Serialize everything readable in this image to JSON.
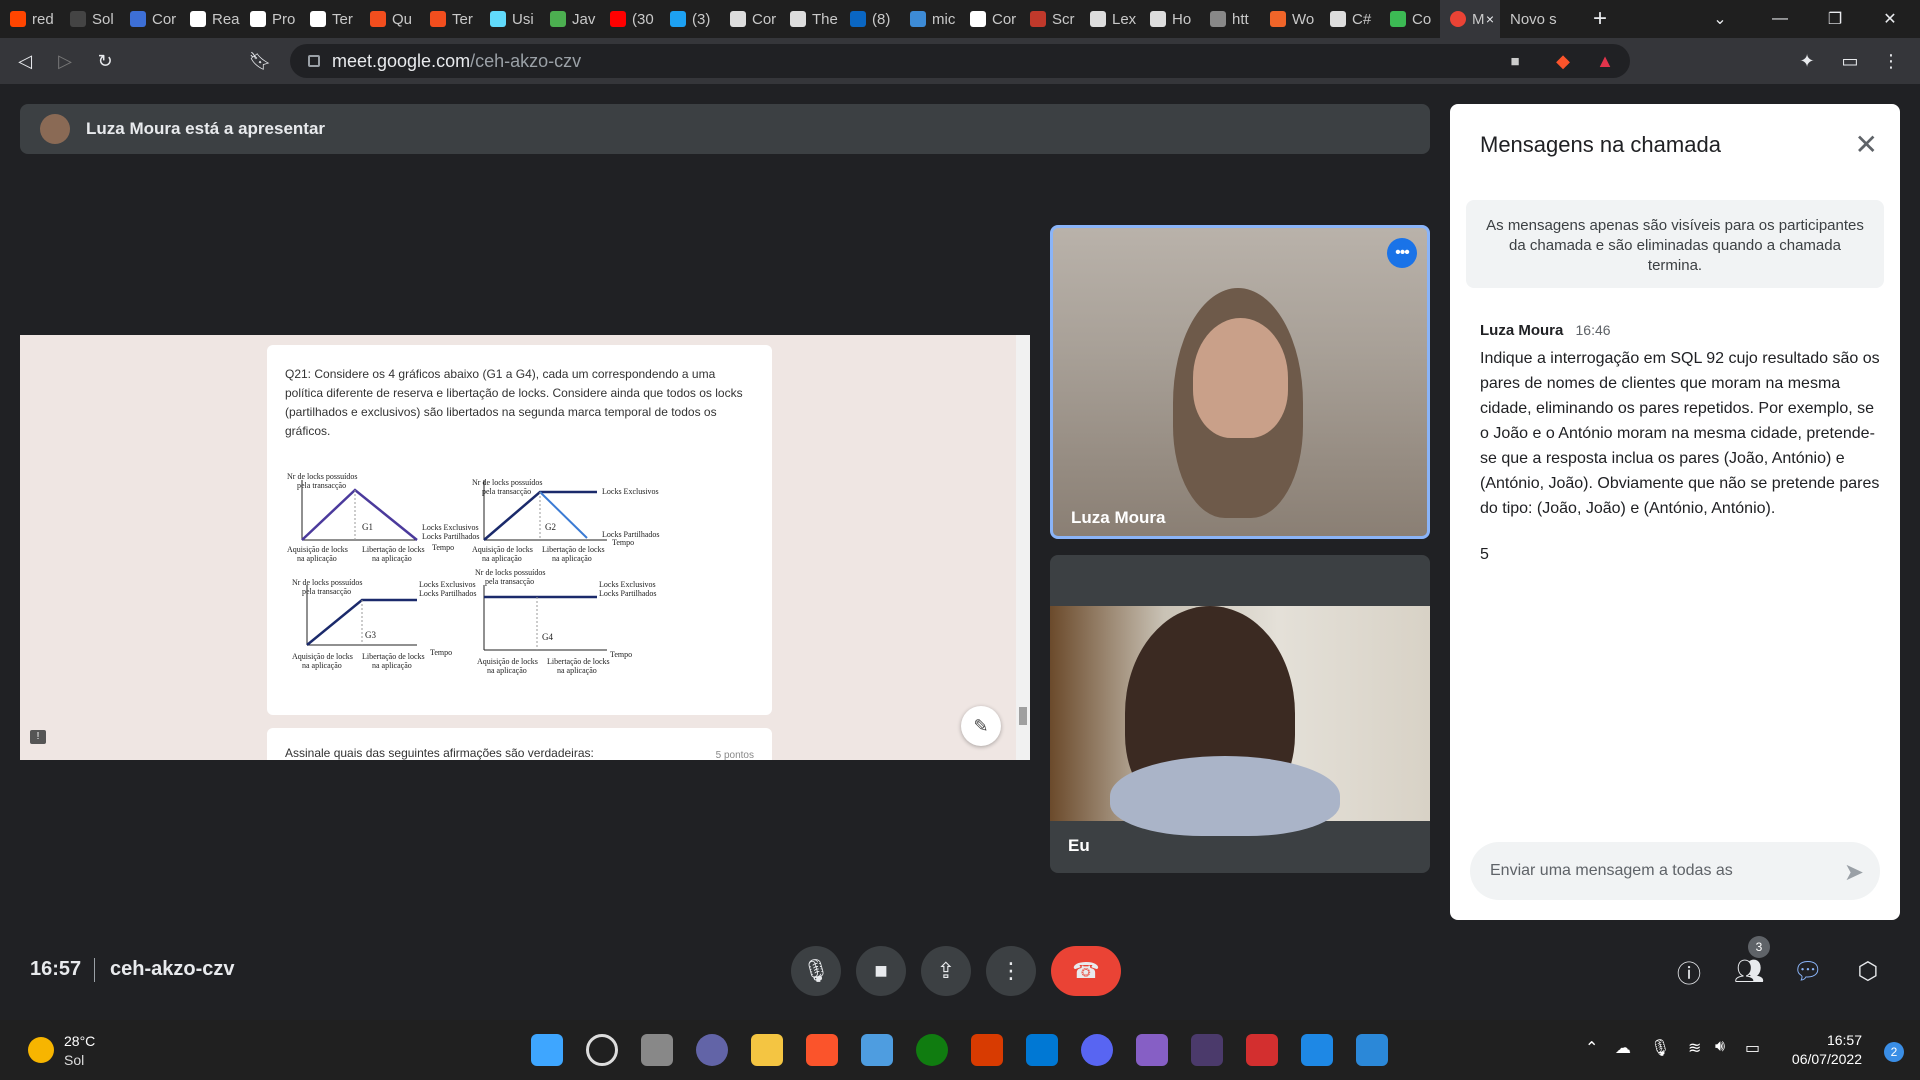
{
  "browser": {
    "tabs": [
      {
        "label": "red",
        "color": "#ff4500"
      },
      {
        "label": "Sol",
        "color": "#444444"
      },
      {
        "label": "Cor",
        "color": "#3d6fd6"
      },
      {
        "label": "Rea",
        "color": "#ffffff"
      },
      {
        "label": "Pro",
        "color": "#ffffff"
      },
      {
        "label": "Ter",
        "color": "#ffffff"
      },
      {
        "label": "Qu",
        "color": "#f24e1e"
      },
      {
        "label": "Ter",
        "color": "#f24e1e"
      },
      {
        "label": "Usi",
        "color": "#61dafb"
      },
      {
        "label": "Jav",
        "color": "#4caf50"
      },
      {
        "label": "(30",
        "color": "#ff0000"
      },
      {
        "label": "(3)",
        "color": "#1da1f2"
      },
      {
        "label": "Cor",
        "color": "#dddddd"
      },
      {
        "label": "The",
        "color": "#dddddd"
      },
      {
        "label": "(8)",
        "color": "#0a66c2"
      },
      {
        "label": "mic",
        "color": "#3d8bd6"
      },
      {
        "label": "Cor",
        "color": "#ffffff"
      },
      {
        "label": "Scr",
        "color": "#c0392b"
      },
      {
        "label": "Lex",
        "color": "#dddddd"
      },
      {
        "label": "Ho",
        "color": "#dddddd"
      },
      {
        "label": "htt",
        "color": "#888888"
      },
      {
        "label": "Wo",
        "color": "#f06529"
      },
      {
        "label": "C#",
        "color": "#dddddd"
      },
      {
        "label": "Co",
        "color": "#3cba54"
      }
    ],
    "active_tab": {
      "label": "M",
      "close": "×"
    },
    "new_tab_label": "Novo s",
    "add_tab": "+",
    "url_host": "meet.google.com",
    "url_path": "/ceh-akzo-czv"
  },
  "presenter": {
    "text": "Luza Moura está a apresentar"
  },
  "shared_screen": {
    "question": "Q21: Considere os 4 gráficos abaixo (G1 a G4), cada um correspondendo a uma política diferente de reserva e libertação de locks. Considere ainda que todos os locks (partilhados e exclusivos) são libertados na segunda marca temporal de todos os gráficos.",
    "graphs": {
      "ylabel_line1": "Nr de locks possuídos",
      "ylabel_line2": "pela transacção",
      "acq_line1": "Aquisição de locks",
      "acq_line2": "na aplicação",
      "rel_line1": "Libertação de locks",
      "rel_line2": "na aplicação",
      "time": "Tempo",
      "excl": "Locks Exclusivos",
      "part": "Locks Partilhados",
      "names": [
        "G1",
        "G2",
        "G3",
        "G4"
      ]
    },
    "next_question": "Assinale quais das seguintes afirmações são verdadeiras:",
    "next_points": "5 pontos"
  },
  "tiles": {
    "luza": {
      "name": "Luza Moura"
    },
    "eu": {
      "name": "Eu"
    }
  },
  "chat": {
    "title": "Mensagens na chamada",
    "notice": "As mensagens apenas são visíveis para os participantes da chamada e são eliminadas quando a chamada termina.",
    "message": {
      "sender": "Luza Moura",
      "time": "16:46",
      "text": "Indique a interrogação em SQL 92 cujo resultado são os pares de nomes de clientes que moram na mesma cidade, eliminando os pares repetidos. Por exemplo, se o João e o António moram na mesma cidade, pretende-se que a resposta inclua os pares (João, António) e (António, João). Obviamente que não se pretende pares do tipo: (João, João) e (António, António).",
      "extra": "5"
    },
    "input_placeholder": "Enviar uma mensagem a todas as"
  },
  "meeting": {
    "time": "16:57",
    "code": "ceh-akzo-czv",
    "participants_count": "3"
  },
  "taskbar": {
    "temp": "28°C",
    "weather": "Sol",
    "time": "16:57",
    "date": "06/07/2022",
    "notifications": "2"
  }
}
